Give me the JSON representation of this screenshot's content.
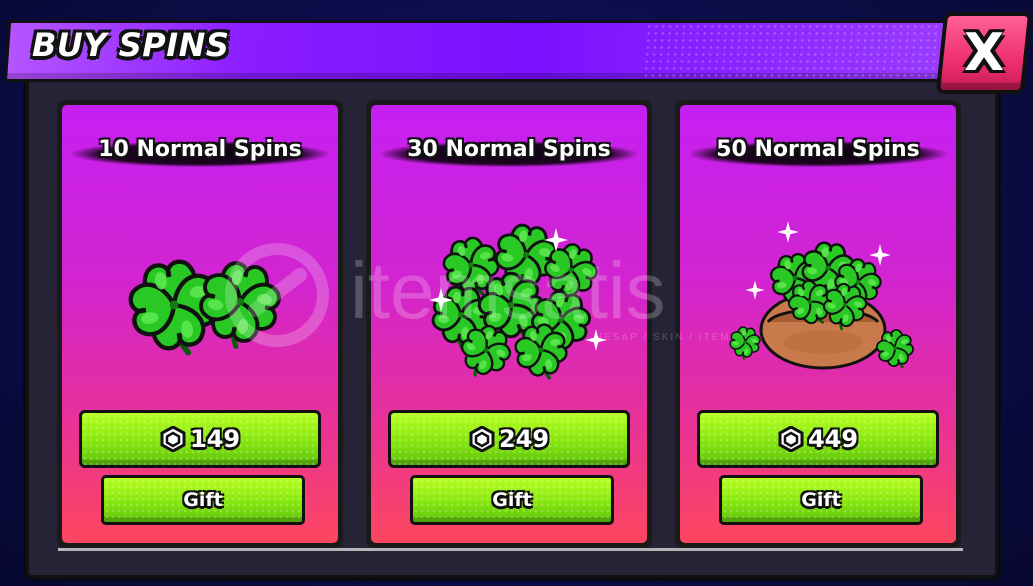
{
  "window": {
    "title": "BUY SPINS",
    "close_label": "X"
  },
  "products": [
    {
      "title": "10 Normal Spins",
      "price": "149",
      "gift_label": "Gift",
      "art_icon": "two-clovers-icon"
    },
    {
      "title": "30 Normal Spins",
      "price": "249",
      "gift_label": "Gift",
      "art_icon": "clover-pile-icon"
    },
    {
      "title": "50 Normal Spins",
      "price": "449",
      "gift_label": "Gift",
      "art_icon": "clover-sack-icon"
    }
  ],
  "currency_icon": "robux-icon",
  "watermark": {
    "text": "itemsatis",
    "subtext": "HESAP / SKIN / ITEM"
  },
  "colors": {
    "title_bar": "#8a1dff",
    "close_button": "#f0306f",
    "card_top": "#c61ff3",
    "card_bottom": "#fd4660",
    "buy_button": "#86e60f",
    "clover": "#21c21c"
  }
}
